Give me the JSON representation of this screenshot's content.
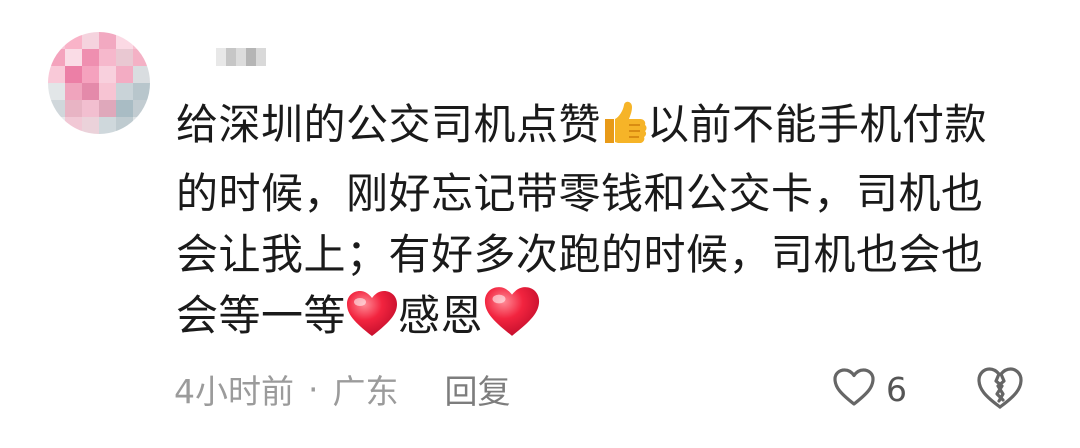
{
  "comment": {
    "lines": [
      "给深圳的公交司机点赞",
      "以前不能手机付款",
      "的时候，刚好忘记带零钱和公交卡，司机也",
      "会让我上；有好多次跑的时候，司机也会也",
      "会等一等",
      "感恩"
    ]
  },
  "meta": {
    "time": "4小时前",
    "separator": "·",
    "location": "广东",
    "reply_label": "回复"
  },
  "actions": {
    "like_count": "6",
    "like_icon": "heart-outline-icon",
    "dislike_icon": "broken-heart-icon"
  },
  "colors": {
    "text": "#1a1a1a",
    "meta": "#9b9b9b",
    "icon": "#666666",
    "heart_emoji": "#f2243f",
    "thumb_emoji": "#f6b428"
  }
}
